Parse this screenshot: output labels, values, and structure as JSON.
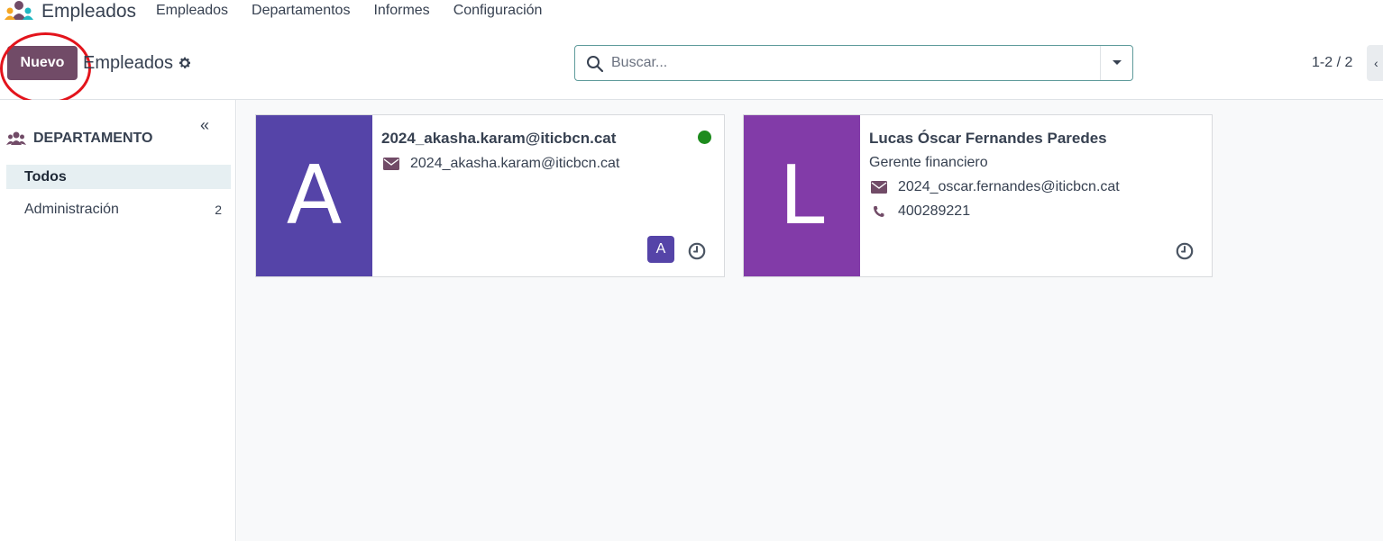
{
  "navbar": {
    "app_name": "Empleados",
    "menu": [
      "Empleados",
      "Departamentos",
      "Informes",
      "Configuración"
    ]
  },
  "control_panel": {
    "new_button": "Nuevo",
    "title": "Empleados",
    "search_placeholder": "Buscar...",
    "pager": "1-2 / 2"
  },
  "sidebar": {
    "header": "DEPARTAMENTO",
    "collapse_glyph": "«",
    "items": [
      {
        "label": "Todos",
        "count": ""
      },
      {
        "label": "Administración",
        "count": "2"
      }
    ]
  },
  "employees": [
    {
      "initial": "A",
      "avatar_color": "#5544a8",
      "name": "2024_akasha.karam@iticbcn.cat",
      "email": "2024_akasha.karam@iticbcn.cat",
      "user_badge": "A",
      "online": true
    },
    {
      "initial": "L",
      "avatar_color": "#823ba8",
      "name": "Lucas Óscar Fernandes Paredes",
      "job_title": "Gerente financiero",
      "email": "2024_oscar.fernandes@iticbcn.cat",
      "phone": "400289221"
    }
  ],
  "colors": {
    "brand": "#714b67",
    "highlight": "#e3141c",
    "online": "#1d8b1d"
  }
}
